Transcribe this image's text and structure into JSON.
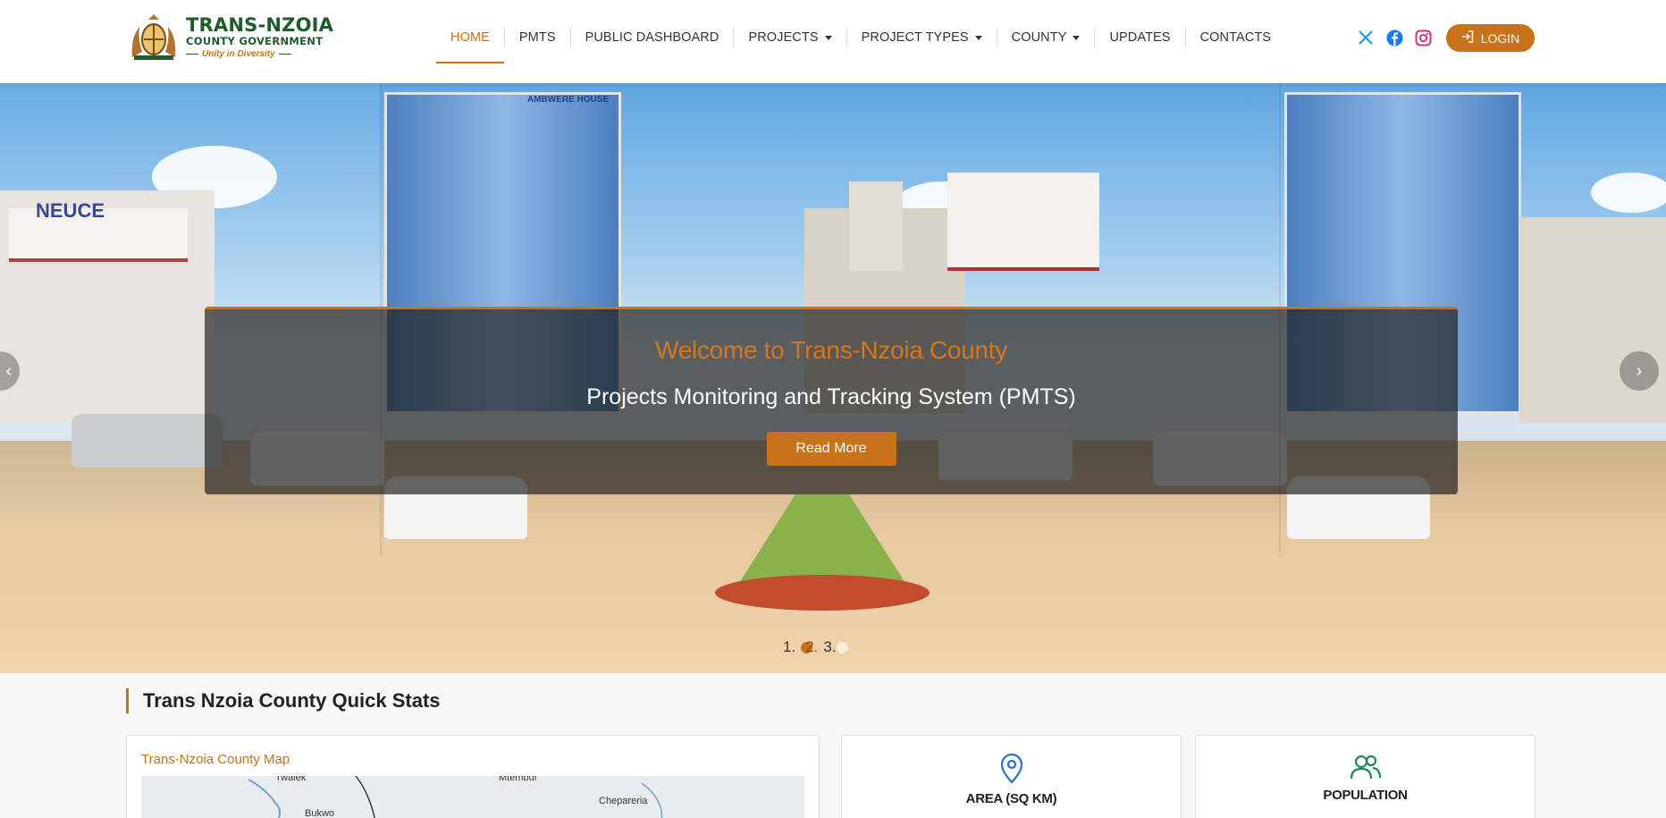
{
  "brand": {
    "name": "TRANS-NZOIA",
    "sub": "COUNTY GOVERNMENT",
    "motto": "Unity in Diversity"
  },
  "nav": {
    "items": [
      {
        "label": "HOME",
        "active": true,
        "dropdown": false
      },
      {
        "label": "PMTS",
        "active": false,
        "dropdown": false
      },
      {
        "label": "PUBLIC DASHBOARD",
        "active": false,
        "dropdown": false
      },
      {
        "label": "PROJECTS",
        "active": false,
        "dropdown": true
      },
      {
        "label": "PROJECT TYPES",
        "active": false,
        "dropdown": true
      },
      {
        "label": "COUNTY",
        "active": false,
        "dropdown": true
      },
      {
        "label": "UPDATES",
        "active": false,
        "dropdown": false
      },
      {
        "label": "CONTACTS",
        "active": false,
        "dropdown": false
      }
    ]
  },
  "social": {
    "icons": [
      "x-icon",
      "facebook-icon",
      "instagram-icon"
    ],
    "colors": {
      "x": "#1d9bf0",
      "facebook": "#1877f2",
      "instagram": "#e1306c"
    }
  },
  "login": {
    "label": "LOGIN"
  },
  "hero": {
    "title": "Welcome to Trans-Nzoia County",
    "subtitle": "Projects Monitoring and Tracking System (PMTS)",
    "button": "Read More",
    "prev": "‹",
    "next": "›",
    "indicators": [
      "1.",
      "2.",
      "3."
    ],
    "active_slide": 2,
    "signs": {
      "building": "AMBWERE HOUSE",
      "store": "NEUCE"
    }
  },
  "stats": {
    "title": "Trans Nzoia County Quick Stats",
    "map": {
      "title": "Trans-Nzoia County Map",
      "places": [
        "Twalek",
        "Mtembur",
        "Chepareria",
        "Bukwo"
      ]
    },
    "cards": [
      {
        "label": "AREA (SQ KM)",
        "icon": "map-pin-icon",
        "color": "#1e73d8"
      },
      {
        "label": "POPULATION",
        "icon": "users-icon",
        "color": "#1a8a52"
      }
    ]
  },
  "colors": {
    "accent": "#c8731a",
    "brand_green": "#1f5a2c"
  }
}
